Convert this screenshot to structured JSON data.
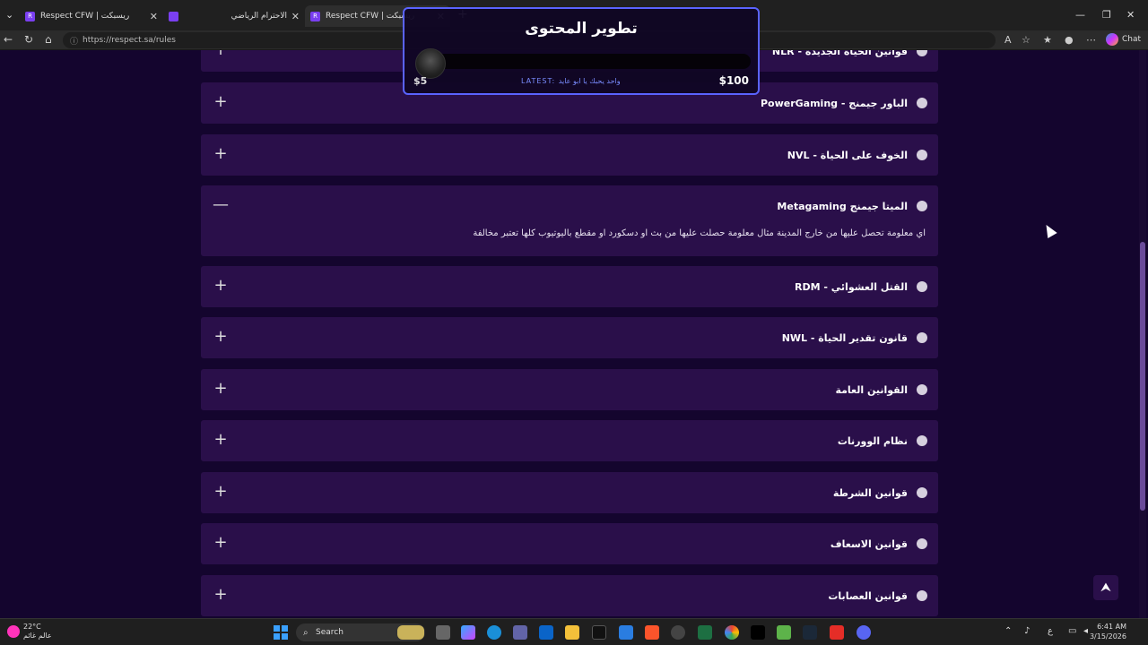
{
  "browser": {
    "tabs": [
      {
        "title": "Respect CFW | ريسبكت",
        "icon": "R"
      },
      {
        "title": "الاحترام الرياضي",
        "icon": ""
      },
      {
        "title": "Respect CFW | ريسبكت",
        "icon": "R"
      }
    ],
    "url": "https://respect.sa/rules",
    "chat_label": "Chat"
  },
  "overlay": {
    "title": "تطوير المحتوى",
    "min": "$5",
    "max": "$100",
    "latest": "LATEST: واحد يحبك يا ابو عايد"
  },
  "rules": [
    {
      "title": "قوانين الحياة الجديدة - NLR",
      "expanded": false,
      "toggle": "+"
    },
    {
      "title": "الباور جيمنج - PowerGaming",
      "expanded": false,
      "toggle": "+"
    },
    {
      "title": "الخوف على الحياة - NVL",
      "expanded": false,
      "toggle": "+"
    },
    {
      "title": "الميتا جيمنج Metagaming",
      "expanded": true,
      "toggle": "—",
      "body": "اي معلومة تحصل عليها من خارج المدينة مثال معلومة حصلت عليها من بث او دسكورد او مقطع باليوتيوب كلها تعتبر مخالفة"
    },
    {
      "title": "القتل العشوائي - RDM",
      "expanded": false,
      "toggle": "+"
    },
    {
      "title": "قانون تقدير الحياة - NWL",
      "expanded": false,
      "toggle": "+"
    },
    {
      "title": "القوانين العامة",
      "expanded": false,
      "toggle": "+"
    },
    {
      "title": "نظام الوورنات",
      "expanded": false,
      "toggle": "+"
    },
    {
      "title": "قوانين الشرطة",
      "expanded": false,
      "toggle": "+"
    },
    {
      "title": "قوانين الاسعاف",
      "expanded": false,
      "toggle": "+"
    },
    {
      "title": "قوانين العصابات",
      "expanded": false,
      "toggle": "+"
    }
  ],
  "back_to_top": "⮝",
  "taskbar": {
    "temp": "22°C",
    "weather_text": "عالم غائم",
    "search": "Search",
    "time": "6:41 AM",
    "date": "3/15/2026"
  }
}
